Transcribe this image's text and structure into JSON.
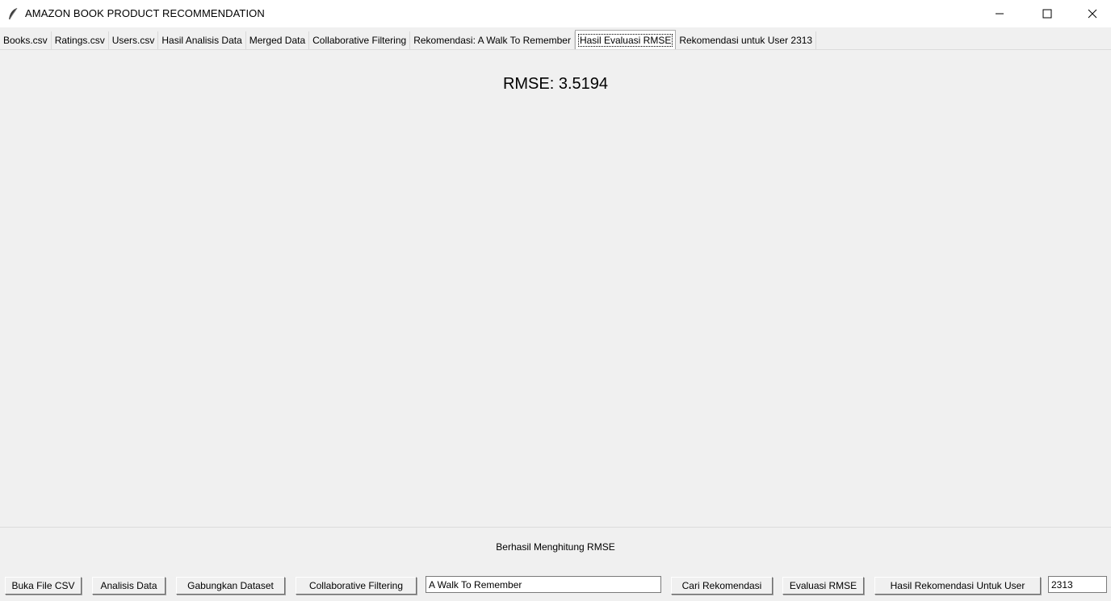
{
  "window": {
    "title": "AMAZON BOOK PRODUCT RECOMMENDATION",
    "icon": "feather-icon",
    "controls": [
      "minimize-icon",
      "maximize-icon",
      "close-icon"
    ]
  },
  "tabs": [
    {
      "label": "Books.csv"
    },
    {
      "label": "Ratings.csv"
    },
    {
      "label": "Users.csv"
    },
    {
      "label": "Hasil Analisis Data"
    },
    {
      "label": "Merged Data"
    },
    {
      "label": "Collaborative Filtering"
    },
    {
      "label": "Rekomendasi: A Walk To Remember"
    },
    {
      "label": "Hasil Evaluasi RMSE"
    },
    {
      "label": "Rekomendasi untuk User 2313"
    }
  ],
  "active_tab": "Hasil Evaluasi RMSE",
  "panel": {
    "rmse_text": "RMSE: 3.5194"
  },
  "status": {
    "message": "Berhasil Menghitung RMSE"
  },
  "toolbar": {
    "open_csv": "Buka File CSV",
    "analyze": "Analisis Data",
    "merge": "Gabungkan Dataset",
    "cf": "Collaborative Filtering",
    "book_input": "A Walk To Remember",
    "find": "Cari Rekomendasi",
    "evaluate": "Evaluasi RMSE",
    "user_results": "Hasil Rekomendasi Untuk User",
    "user_input": "2313"
  }
}
